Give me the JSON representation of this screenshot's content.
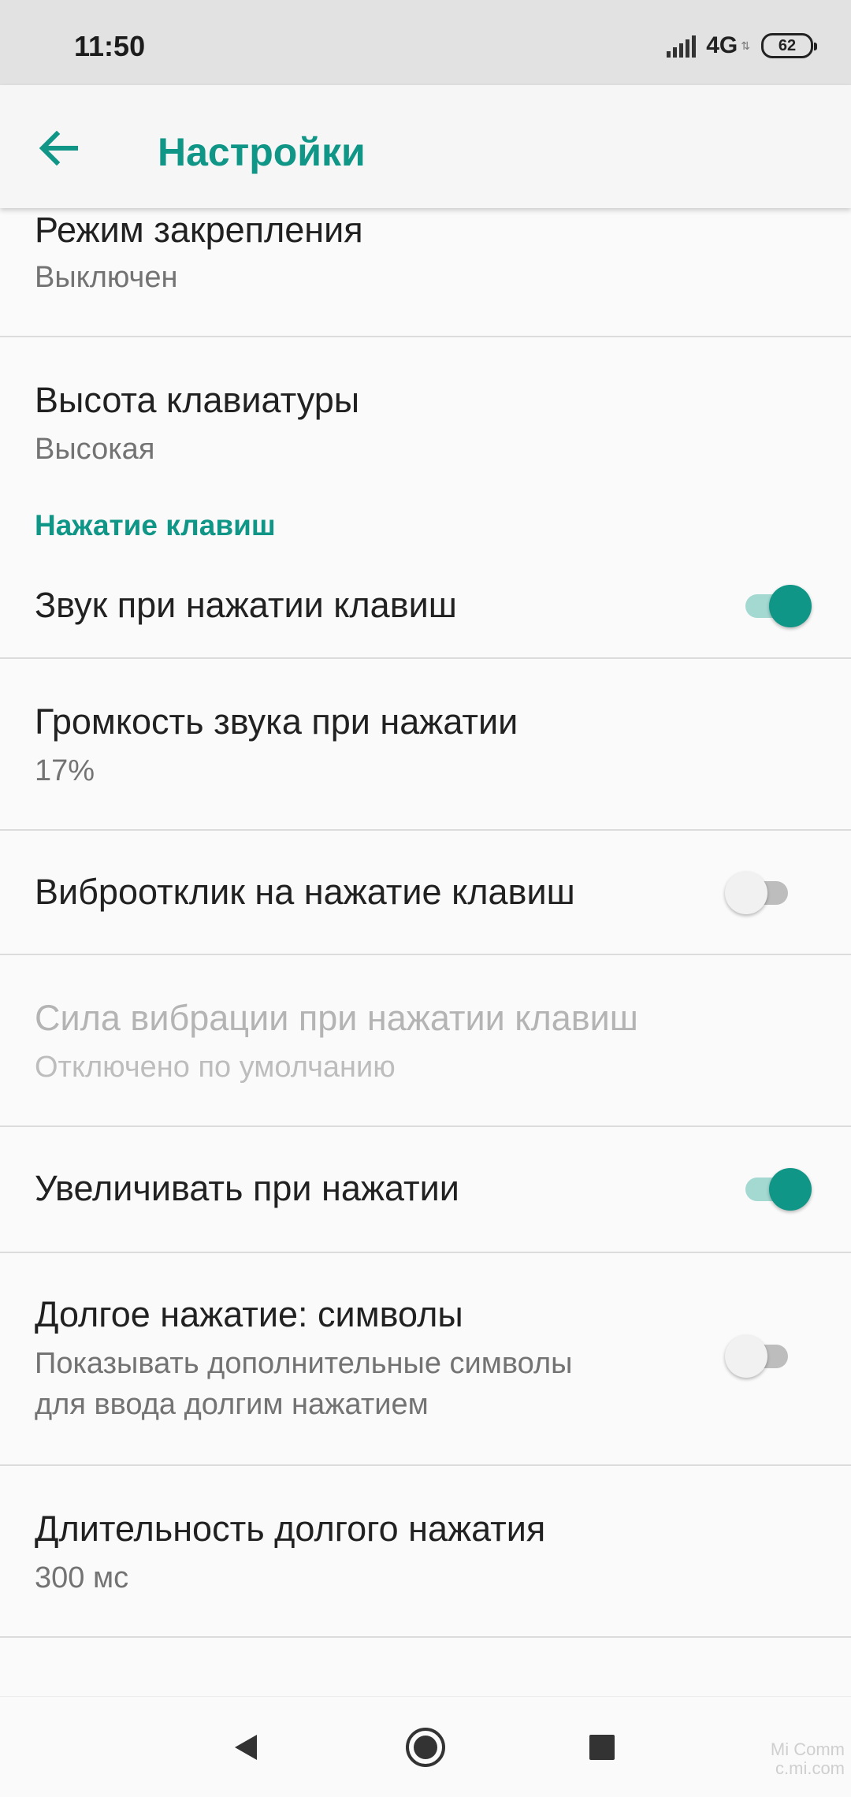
{
  "status_bar": {
    "time": "11:50",
    "network": "4G",
    "battery": "62"
  },
  "toolbar": {
    "title": "Настройки"
  },
  "items": {
    "pinning_mode": {
      "title": "Режим закрепления",
      "subtitle": "Выключен"
    },
    "keyboard_height": {
      "title": "Высота клавиатуры",
      "subtitle": "Высокая"
    },
    "section_keypress": {
      "title": "Нажатие клавиш"
    },
    "key_sound": {
      "title": "Звук при нажатии клавиш",
      "enabled": true
    },
    "sound_volume": {
      "title": "Громкость звука при нажатии",
      "subtitle": "17%"
    },
    "haptic": {
      "title": "Виброотклик на нажатие клавиш",
      "enabled": false
    },
    "vibration_strength": {
      "title": "Сила вибрации при нажатии клавиш",
      "subtitle": "Отключено по умолчанию"
    },
    "popup_on_press": {
      "title": "Увеличивать при нажатии",
      "enabled": true
    },
    "long_press_symbols": {
      "title": "Долгое нажатие: символы",
      "subtitle_line1": "Показывать дополнительные символы",
      "subtitle_line2": "для ввода долгим нажатием",
      "enabled": false
    },
    "long_press_delay": {
      "title": "Длительность долгого нажатия",
      "subtitle": "300 мс"
    }
  },
  "watermark": {
    "line1": "Mi Comm",
    "line2": "c.mi.com"
  },
  "colors": {
    "accent": "#0f9687",
    "accent_track": "#a4d9d2",
    "status_bar": "#e2e2e2"
  },
  "icons": {
    "back": "arrow-left-icon",
    "nav_back": "triangle-back-icon",
    "nav_home": "circle-home-icon",
    "nav_recents": "square-recents-icon"
  }
}
